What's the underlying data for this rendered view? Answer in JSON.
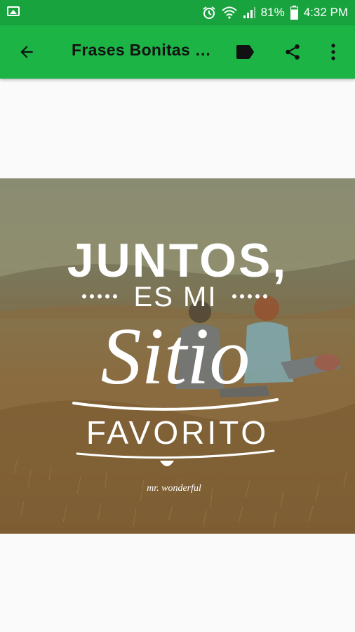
{
  "status_bar": {
    "left_icon": "image-icon",
    "alarm_icon": "alarm-icon",
    "wifi_icon": "wifi-icon",
    "signal_icon": "signal-icon",
    "battery_percent": "81%",
    "battery_icon": "battery-icon",
    "time": "4:32 PM"
  },
  "app_bar": {
    "back_icon": "arrow-back-icon",
    "title": "Frases Bonitas de Amor",
    "label_icon": "label-icon",
    "share_icon": "share-icon",
    "more_icon": "more-vert-icon",
    "background_color": "#1db446"
  },
  "image": {
    "line1": "JUNTOS,",
    "line2": "ES MI",
    "line3": "Sitio",
    "line4": "FAVORITO",
    "signature": "mr. wonderful"
  }
}
